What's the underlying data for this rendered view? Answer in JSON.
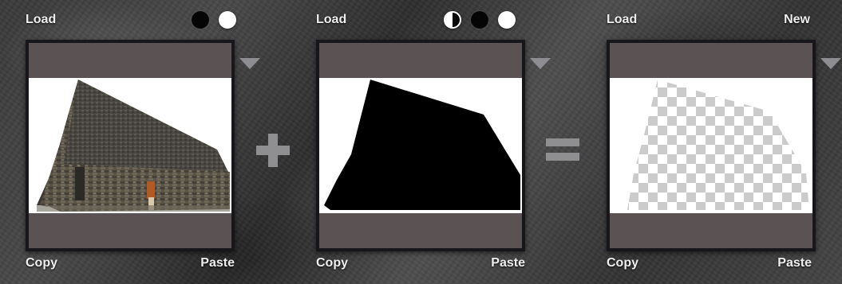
{
  "panels": [
    {
      "id": "source",
      "load_label": "Load",
      "copy_label": "Copy",
      "paste_label": "Paste",
      "image_subject": "stone-barn-photo",
      "dots": [
        "black",
        "white"
      ]
    },
    {
      "id": "mask",
      "load_label": "Load",
      "copy_label": "Copy",
      "paste_label": "Paste",
      "image_subject": "black-barn-silhouette",
      "dots": [
        "half",
        "black",
        "white"
      ]
    },
    {
      "id": "result",
      "load_label": "Load",
      "new_label": "New",
      "copy_label": "Copy",
      "paste_label": "Paste",
      "image_subject": "transparent-checker-shape"
    }
  ],
  "operators": {
    "plus_icon": "plus-icon",
    "equals_icon": "equals-icon"
  },
  "icons": {
    "menu": "triangle-down-icon",
    "swatch_black": "black-dot-icon",
    "swatch_white": "white-dot-icon",
    "swatch_half": "half-dot-icon"
  },
  "colors": {
    "tile_band": "#5a5253",
    "tile_border": "#17161a",
    "text": "#eeeeee",
    "operator": "#8f8f91",
    "triangle": "#8d8d92"
  }
}
